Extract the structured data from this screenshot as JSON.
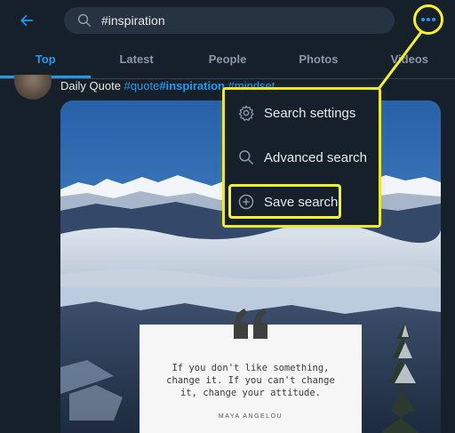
{
  "search": {
    "value": "#inspiration"
  },
  "tabs": [
    {
      "label": "Top",
      "active": true
    },
    {
      "label": "Latest",
      "active": false
    },
    {
      "label": "People",
      "active": false
    },
    {
      "label": "Photos",
      "active": false
    },
    {
      "label": "Videos",
      "active": false
    }
  ],
  "tweet": {
    "author": "Daily Quote",
    "tags": [
      "#quote",
      "#inspiration",
      "#mindset"
    ]
  },
  "menu": {
    "items": [
      {
        "label": "Search settings",
        "icon": "gear-icon"
      },
      {
        "label": "Advanced search",
        "icon": "search-icon"
      },
      {
        "label": "Save search",
        "icon": "plus-circle-icon"
      }
    ]
  },
  "quote": {
    "line1": "If you don't like something,",
    "line2": "change it. If you can't change",
    "line3": "it, change your attitude.",
    "author": "MAYA ANGELOU"
  },
  "colors": {
    "background": "#15202b",
    "accent": "#1d9bf0",
    "highlight": "#f7f221"
  }
}
